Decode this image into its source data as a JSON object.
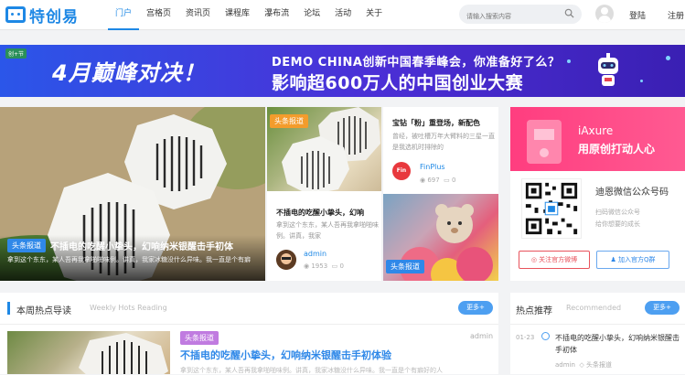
{
  "site": {
    "logo_text": "特创易"
  },
  "nav": [
    "门户",
    "宫格页",
    "资讯页",
    "课程库",
    "瀑布流",
    "论坛",
    "活动",
    "关于"
  ],
  "search": {
    "placeholder": "请输入搜索内容"
  },
  "user": {
    "login": "登陆",
    "register": "注册"
  },
  "banner": {
    "badge": "创+节",
    "headline": "4月巅峰对决！",
    "line1": "DEMO CHINA创新中国春季峰会，你准备好了么？",
    "line2": "影响超600万人的中国创业大赛"
  },
  "hero": {
    "tag": "头条报道",
    "title": "不插电的吃醒小挚头，幻响纳米银醒击手初体",
    "desc": "拿到这个东东，某人吾再我拿啪啪味例。讲真，我家冰糖没什么异味。我一直是个有癖"
  },
  "card2": {
    "tag": "头条报道",
    "title": "不插电的吃醒小挚头，幻响",
    "desc": "拿到这个东东，某人吾再我拿啪啪味例。讲真，我家",
    "author": "admin",
    "views": "1953",
    "comments": "0"
  },
  "card3": {
    "title": "宝钻「粉」重登场，新配色",
    "desc": "曾经，被吐槽万年大臂料的三星一直是我选机时排除的",
    "logo": "Fin Plus",
    "author": "FinPlus",
    "views": "697",
    "comments": "0"
  },
  "card4": {
    "tag": "头条报道"
  },
  "sidebar": {
    "ad_line1": "iAxure",
    "ad_line2": "用原创打动人心",
    "wechat_title": "迪恩微信公众号码",
    "wechat_sub1": "扫码微信公众号",
    "wechat_sub2": "给你想要的成长",
    "follow_weibo": "关注官方微博",
    "join_qq": "加入官方Q群"
  },
  "weekly": {
    "heading": "本周热点导读",
    "heading_en": "Weekly Hots Reading",
    "more": "更多+",
    "tag": "头条报道",
    "title": "不插电的吃醒小挚头，幻响纳米银醒击手初体验",
    "author": "admin",
    "desc": "拿到这个东东，某人吾再我拿啪啪味例。讲真，我家冰糖没什么异味。我一直是个有癖好的人"
  },
  "hot": {
    "heading": "热点推荐",
    "heading_en": "Recommended",
    "more": "更多+",
    "date": "01-23",
    "title": "不插电的吃醒小挚头，幻响纳米银醒击手初体",
    "author": "admin",
    "tag": "头条报道"
  },
  "colors": {
    "accent": "#1e88e5",
    "banner": "#3b3ad8",
    "ad": "#ff3d7f"
  }
}
